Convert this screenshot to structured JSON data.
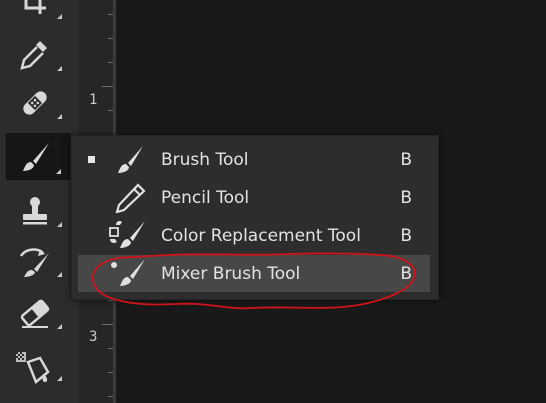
{
  "ruler": {
    "labels": [
      "1",
      "3"
    ]
  },
  "tools": [
    {
      "name": "crop-tool-button",
      "icon": "crop-icon"
    },
    {
      "name": "eyedropper-tool-button",
      "icon": "eyedropper-icon"
    },
    {
      "name": "healing-brush-tool-button",
      "icon": "bandage-icon"
    },
    {
      "name": "brush-tool-button",
      "icon": "brush-icon",
      "active": true
    },
    {
      "name": "clone-stamp-tool-button",
      "icon": "stamp-icon"
    },
    {
      "name": "history-brush-tool-button",
      "icon": "history-brush-icon"
    },
    {
      "name": "eraser-tool-button",
      "icon": "eraser-icon"
    },
    {
      "name": "paint-bucket-tool-button",
      "icon": "paint-bucket-icon"
    }
  ],
  "menu": {
    "items": [
      {
        "label": "Brush Tool",
        "shortcut": "B",
        "icon": "brush-icon",
        "selected": true
      },
      {
        "label": "Pencil Tool",
        "shortcut": "B",
        "icon": "pencil-icon"
      },
      {
        "label": "Color Replacement Tool",
        "shortcut": "B",
        "icon": "color-replacement-icon"
      },
      {
        "label": "Mixer Brush Tool",
        "shortcut": "B",
        "icon": "mixer-brush-icon",
        "highlighted": true
      }
    ]
  },
  "colors": {
    "toolbar": "#2c2c2c",
    "canvas": "#191919",
    "menu": "#2d2d2d",
    "menu_hover": "#474747",
    "text": "#e3e3e3",
    "annotation": "#d0141a"
  }
}
